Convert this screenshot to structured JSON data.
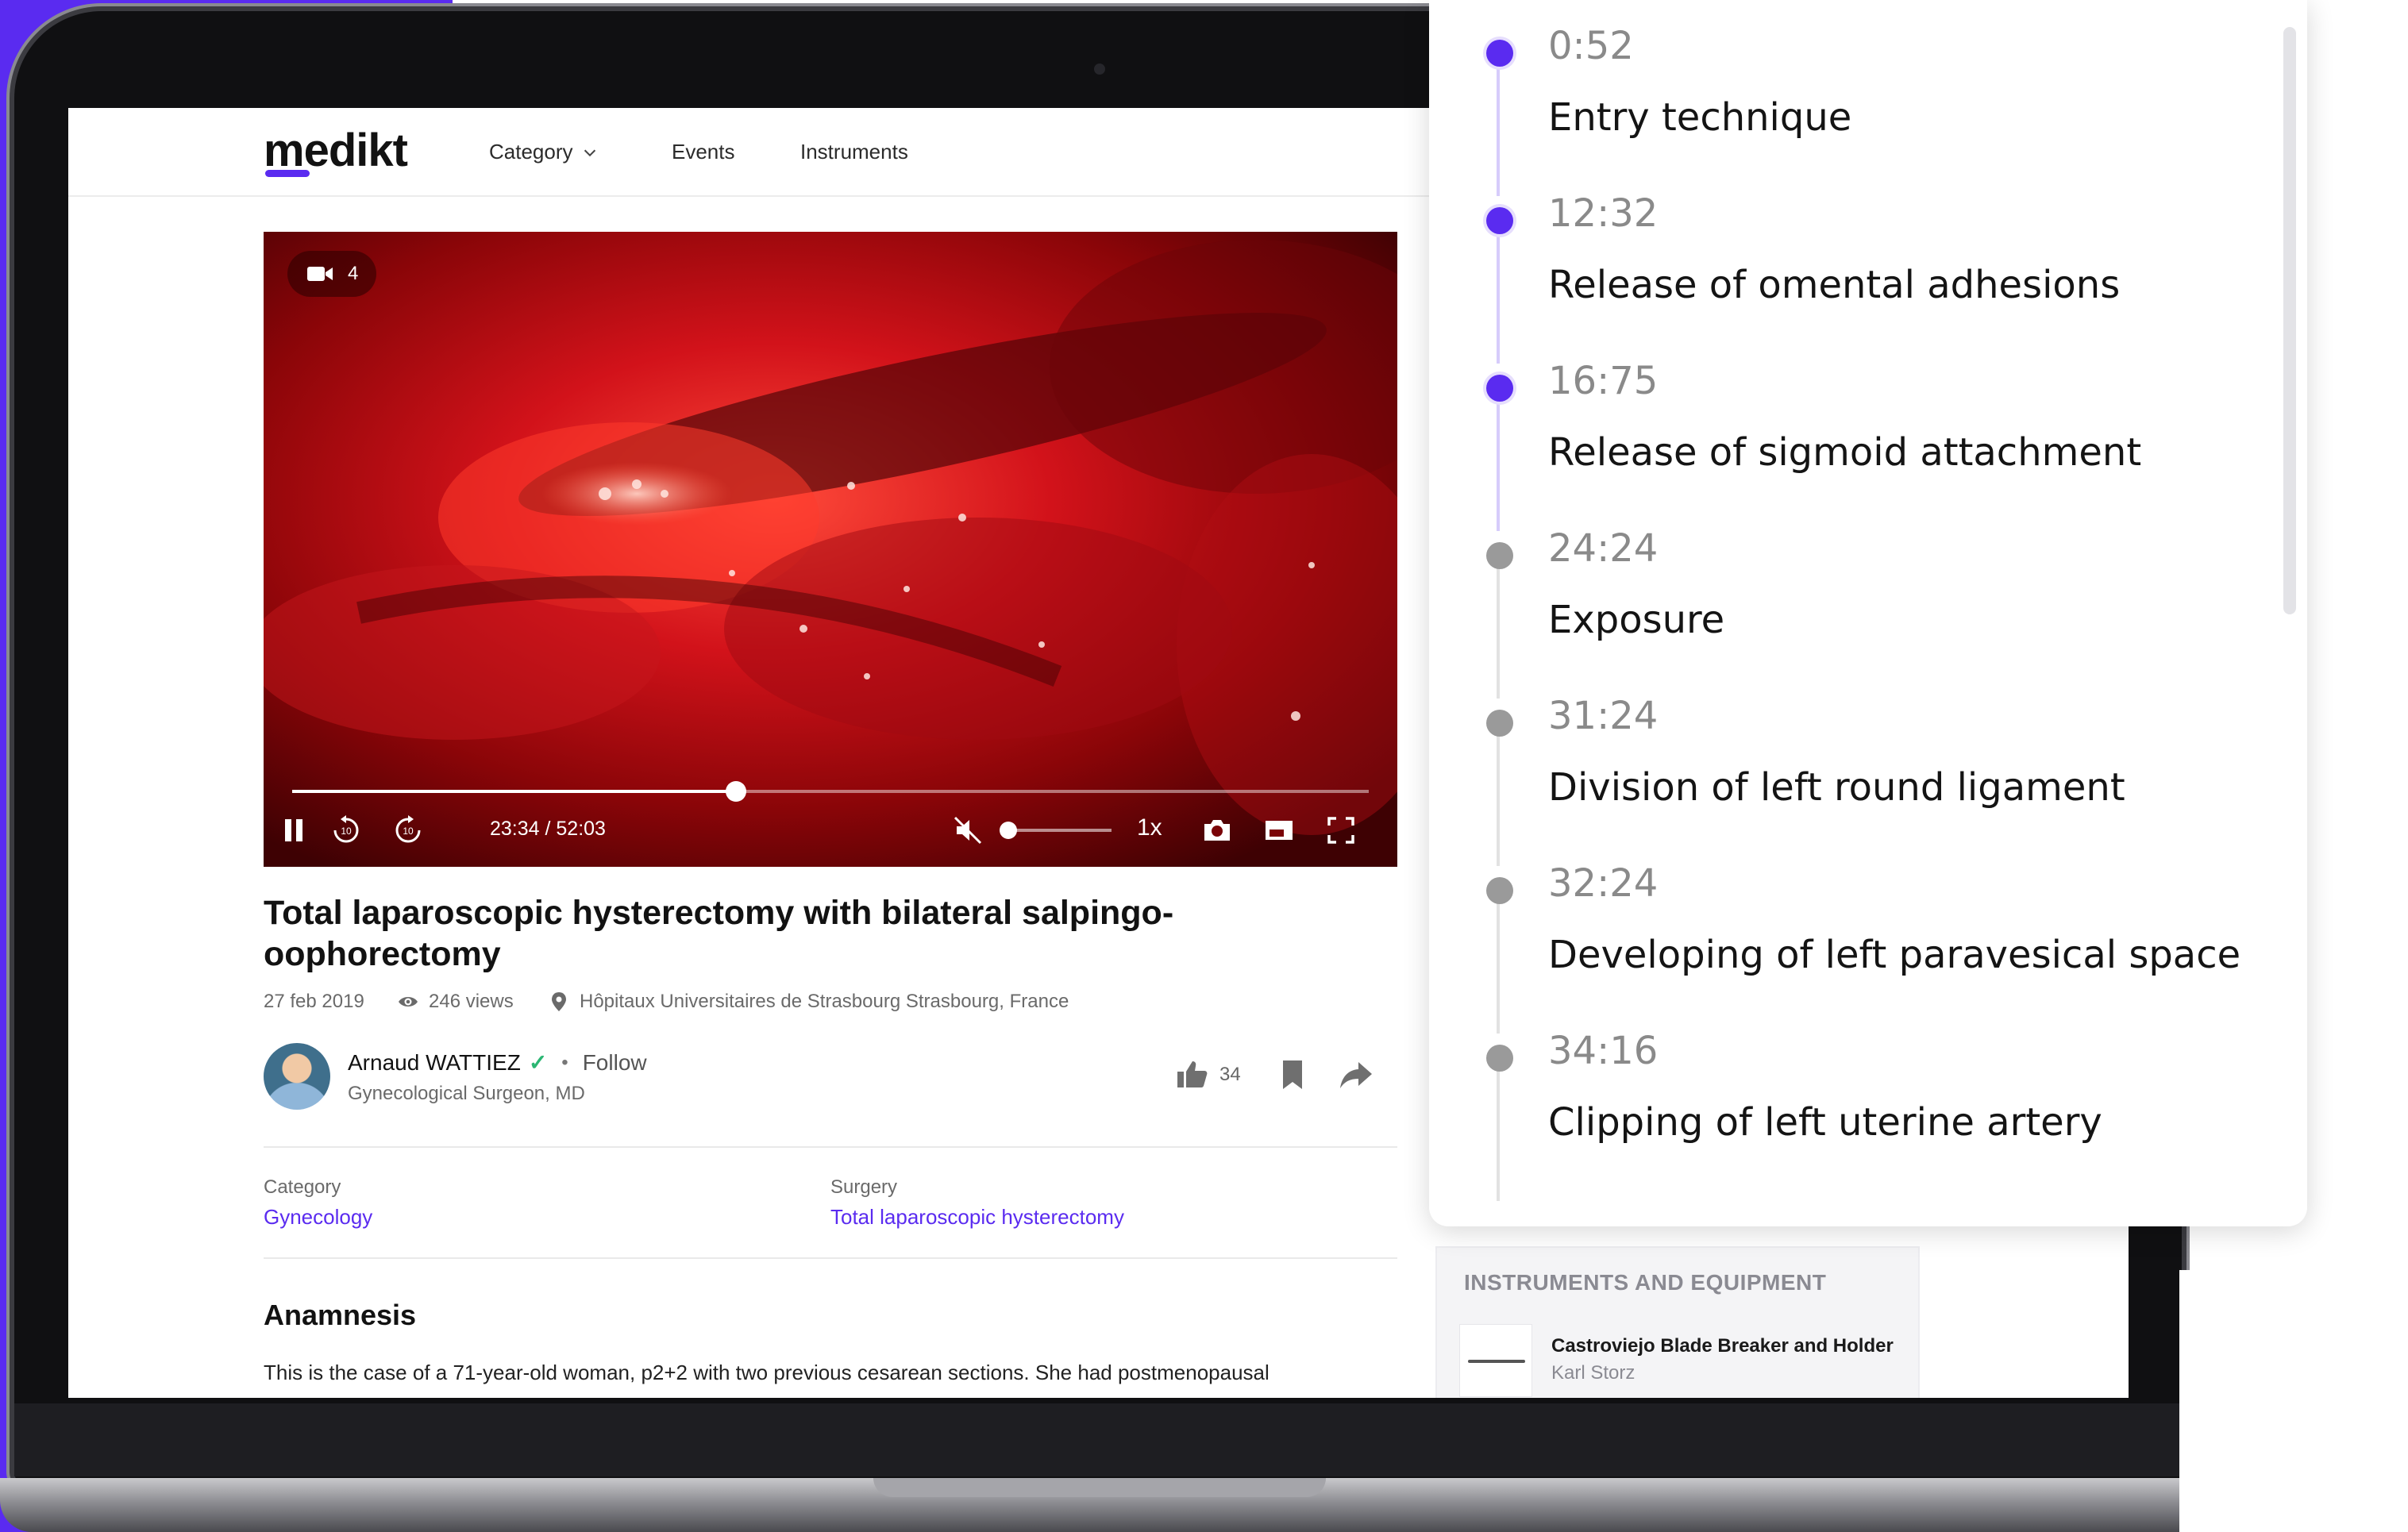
{
  "colors": {
    "accent": "#5a2bf0",
    "dot_inactive": "#9a9a9a",
    "line_active": "#d6ccfb",
    "line_inactive": "#e2e2e2"
  },
  "header": {
    "logo": "medikt",
    "nav": [
      {
        "label": "Category",
        "icon": "chevron-down-icon"
      },
      {
        "label": "Events"
      },
      {
        "label": "Instruments"
      }
    ]
  },
  "video": {
    "camera_count": "4",
    "time": "23:34 / 52:03",
    "progress": 0.4126,
    "volume": 0.0,
    "speed": "1x",
    "muted": true
  },
  "article": {
    "title": "Total laparoscopic hysterectomy with bilateral salpingo-oophorectomy",
    "date": "27 feb 2019",
    "views": "246 views",
    "location": "Hôpitaux Universitaires de Strasbourg Strasbourg, France",
    "author": {
      "name": "Arnaud WATTIEZ",
      "role": "Gynecological Surgeon, MD",
      "follow_label": "Follow",
      "verified": true
    },
    "likes": "34",
    "category_label": "Category",
    "category_value": "Gynecology",
    "surgery_label": "Surgery",
    "surgery_value": "Total laparoscopic hysterectomy",
    "section_title": "Anamnesis",
    "section_text": "This is the case of a 71-year-old woman, p2+2 with two previous cesarean sections. She had postmenopausal"
  },
  "instruments": {
    "heading": "INSTRUMENTS AND EQUIPMENT",
    "items": [
      {
        "name": "Castroviejo Blade Breaker and Holder",
        "brand": "Karl Storz"
      }
    ]
  },
  "chapters": [
    {
      "time": "0:52",
      "title": "Entry technique",
      "active": true
    },
    {
      "time": "12:32",
      "title": "Release of omental adhesions",
      "active": true
    },
    {
      "time": "16:75",
      "title": "Release of sigmoid attachment",
      "active": true
    },
    {
      "time": "24:24",
      "title": "Exposure",
      "active": false
    },
    {
      "time": "31:24",
      "title": "Division of left round ligament",
      "active": false
    },
    {
      "time": "32:24",
      "title": "Developing of left paravesical space",
      "active": false
    },
    {
      "time": "34:16",
      "title": "Clipping of left uterine artery",
      "active": false
    }
  ]
}
